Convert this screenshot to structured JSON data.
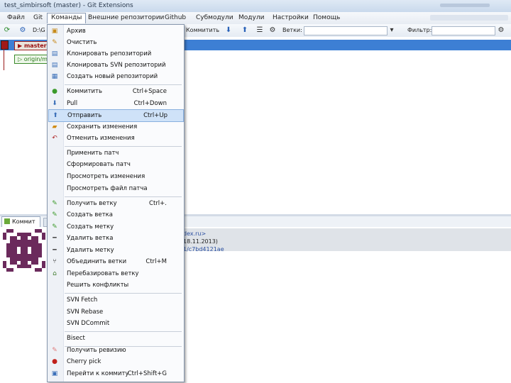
{
  "window": {
    "title": "test_simbirsoft (master) - Git Extensions"
  },
  "menubar": {
    "items": [
      "Файл",
      "Git",
      "Команды",
      "Внешние репозитории",
      "Github",
      "Субмодули",
      "Модули",
      "Настройки",
      "Помощь"
    ],
    "active": "Команды"
  },
  "toolbar": {
    "left_text": "D:\\G",
    "commit_label": "Коммитить",
    "branch_label": "Ветки:",
    "filter_label": "Фильтр:"
  },
  "branches": {
    "master": "master",
    "origin": "origin/m"
  },
  "tabs": {
    "commit": "Коммит"
  },
  "details": {
    "email_fragment": "dex.ru>",
    "date_fragment": "18.11.2013)",
    "hash_fragment": "1/c7bd4121ae"
  },
  "menu": {
    "items": [
      {
        "icon": "archive-icon",
        "label": "Архив",
        "shortcut": ""
      },
      {
        "icon": "broom-icon",
        "label": "Очистить",
        "shortcut": ""
      },
      {
        "icon": "clone-icon",
        "label": "Клонировать репозиторий",
        "shortcut": ""
      },
      {
        "icon": "clone-svn-icon",
        "label": "Клонировать SVN репозиторий",
        "shortcut": ""
      },
      {
        "icon": "new-repo-icon",
        "label": "Создать новый репозиторий",
        "shortcut": ""
      },
      {
        "icon": "commit-icon",
        "label": "Коммитить",
        "shortcut": "Ctrl+Space"
      },
      {
        "icon": "pull-icon",
        "label": "Pull",
        "shortcut": "Ctrl+Down"
      },
      {
        "icon": "push-icon",
        "label": "Отправить",
        "shortcut": "Ctrl+Up"
      },
      {
        "icon": "stash-icon",
        "label": "Сохранить изменения",
        "shortcut": ""
      },
      {
        "icon": "reset-icon",
        "label": "Отменить изменения",
        "shortcut": ""
      },
      {
        "icon": "",
        "label": "Применить патч",
        "shortcut": ""
      },
      {
        "icon": "",
        "label": "Сформировать патч",
        "shortcut": ""
      },
      {
        "icon": "",
        "label": "Просмотреть изменения",
        "shortcut": ""
      },
      {
        "icon": "",
        "label": "Просмотреть файл патча",
        "shortcut": ""
      },
      {
        "icon": "checkout-icon",
        "label": "Получить ветку",
        "shortcut": "Ctrl+."
      },
      {
        "icon": "create-branch-icon",
        "label": "Создать ветка",
        "shortcut": ""
      },
      {
        "icon": "create-tag-icon",
        "label": "Создать метку",
        "shortcut": ""
      },
      {
        "icon": "delete-branch-icon",
        "label": "Удалить ветка",
        "shortcut": ""
      },
      {
        "icon": "delete-tag-icon",
        "label": "Удалить метку",
        "shortcut": ""
      },
      {
        "icon": "merge-icon",
        "label": "Объединить ветки",
        "shortcut": "Ctrl+M"
      },
      {
        "icon": "rebase-icon",
        "label": "Перебазировать ветку",
        "shortcut": ""
      },
      {
        "icon": "",
        "label": "Решить конфликты",
        "shortcut": ""
      },
      {
        "icon": "",
        "label": "SVN Fetch",
        "shortcut": ""
      },
      {
        "icon": "",
        "label": "SVN Rebase",
        "shortcut": ""
      },
      {
        "icon": "",
        "label": "SVN DCommit",
        "shortcut": ""
      },
      {
        "icon": "",
        "label": "Bisect",
        "shortcut": ""
      },
      {
        "icon": "checkout-revision-icon",
        "label": "Получить ревизию",
        "shortcut": ""
      },
      {
        "icon": "cherry-pick-icon",
        "label": "Cherry pick",
        "shortcut": ""
      },
      {
        "icon": "goto-commit-icon",
        "label": "Перейти к коммиту",
        "shortcut": "Ctrl+Shift+G"
      }
    ],
    "highlighted": "Отправить"
  }
}
